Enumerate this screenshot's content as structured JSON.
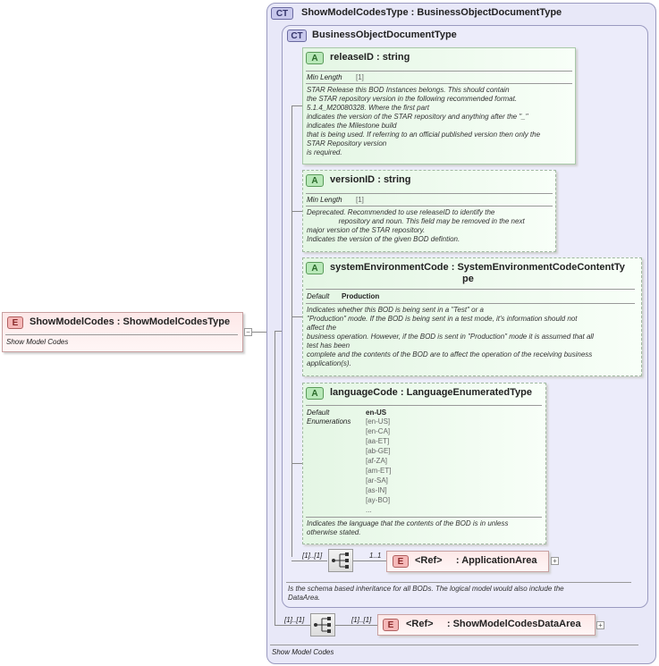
{
  "root": {
    "badge": "E",
    "name": "ShowModelCodes",
    "sep": ":",
    "type": "ShowModelCodesType",
    "doc": "Show Model Codes"
  },
  "outer_type": {
    "badge": "CT",
    "name": "ShowModelCodesType",
    "sep": ":",
    "base": "BusinessObjectDocumentType",
    "doc": "Show Model Codes"
  },
  "inner_type": {
    "badge": "CT",
    "name": "BusinessObjectDocumentType",
    "doc": "Is the schema based inheritance for all BODs. The logical model would also include the\nDataArea."
  },
  "attributes": [
    {
      "badge": "A",
      "name": "releaseID",
      "sep": ":",
      "type": "string",
      "facet_label": "Min Length",
      "facet_value": "[1]",
      "doc": "STAR Release this BOD Instances belongs. This should contain\nthe STAR repository version in the following recommended format.\n5.1.4_M20080328. Where the first part\nindicates the version of the STAR repository and anything after the \"_\"\nindicates the Milestone build\nthat is being used. If referring to an official published version then only the\nSTAR Repository version\nis required."
    },
    {
      "badge": "A",
      "name": "versionID",
      "sep": ":",
      "type": "string",
      "facet_label": "Min Length",
      "facet_value": "[1]",
      "doc": "Deprecated. Recommended to use releaseID to identify the\n                repository and noun. This field may be removed in the next\nmajor version of the STAR repository.\nIndicates the version of the given BOD defintion."
    },
    {
      "badge": "A",
      "name": "systemEnvironmentCode",
      "sep": ":",
      "type_line1": "SystemEnvironmentCodeContentTy",
      "type_line2": "pe",
      "facet_label": "Default",
      "facet_value": "Production",
      "doc": "Indicates whether this BOD is being sent in a \"Test\" or a\n\"Production\" mode. If the BOD is being sent in a test mode, it's information should not\naffect the\nbusiness operation. However, if the BOD is sent in \"Production\" mode it is assumed that all\ntest has been\ncomplete and the contents of the BOD are to affect the operation of the receiving business\napplication(s)."
    },
    {
      "badge": "A",
      "name": "languageCode",
      "sep": ":",
      "type": "LanguageEnumeratedType",
      "facet_label": "Default",
      "facet_value": "en-US",
      "enum_label": "Enumerations",
      "enumerations": [
        "[en-US]",
        "[en-CA]",
        "[aa-ET]",
        "[ab-GE]",
        "[af-ZA]",
        "[am-ET]",
        "[ar-SA]",
        "[as-IN]",
        "[ay-BO]",
        "..."
      ],
      "doc": "Indicates the language that the contents of the BOD is in unless\notherwise stated."
    }
  ],
  "application_area": {
    "seq_card": "[1]..[1]",
    "card": "1..1",
    "badge": "E",
    "ref": "<Ref>",
    "sep": ":",
    "name": "ApplicationArea"
  },
  "data_area": {
    "seq_card": "[1]..[1]",
    "card": "[1]..[1]",
    "badge": "E",
    "ref": "<Ref>",
    "sep": ":",
    "name": "ShowModelCodesDataArea"
  },
  "colors": {
    "ct_fill": "#e8e8f8",
    "attr_fill": "#e4f6e4",
    "element_fill": "#fde8e8"
  }
}
